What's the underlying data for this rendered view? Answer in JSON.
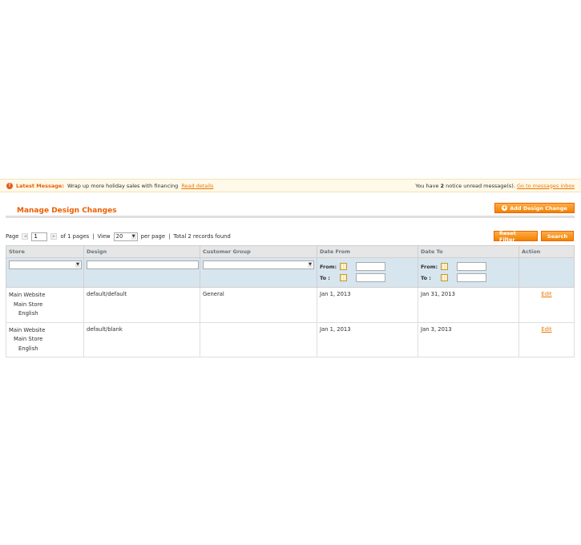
{
  "notice": {
    "icon": "alert-icon",
    "label": "Latest Message:",
    "message": "Wrap up more holiday sales with financing",
    "link": "Read details",
    "right_prefix": "You have",
    "unread_count": "2",
    "right_suffix": "notice unread message(s).",
    "right_link": "Go to messages inbox"
  },
  "page": {
    "title": "Manage Design Changes",
    "add_button": "Add Design Change"
  },
  "pager": {
    "page_label": "Page",
    "current_page": "1",
    "of_pages": "of 1 pages",
    "sep1": "|",
    "view_label": "View",
    "per_page_value": "20",
    "per_page_label": "per page",
    "sep2": "|",
    "total": "Total 2 records found",
    "reset_button": "Reset Filter",
    "search_button": "Search"
  },
  "table": {
    "columns": [
      "Store",
      "Design",
      "Customer Group",
      "Date From",
      "Date To",
      "Action"
    ],
    "filter": {
      "from_label": "From:",
      "to_label": "To :"
    },
    "rows": [
      {
        "store": [
          "Main Website",
          "Main Store",
          "English"
        ],
        "design": "default/default",
        "customer_group": "General",
        "date_from": "Jan 1, 2013",
        "date_to": "Jan 31, 2013",
        "action": "Edit"
      },
      {
        "store": [
          "Main Website",
          "Main Store",
          "English"
        ],
        "design": "default/blank",
        "customer_group": "",
        "date_from": "Jan 1, 2013",
        "date_to": "Jan 3, 2013",
        "action": "Edit"
      }
    ]
  },
  "colors": {
    "accent": "#eb5e00",
    "button": "#f18200",
    "filter_bg": "#d7e5ef"
  }
}
